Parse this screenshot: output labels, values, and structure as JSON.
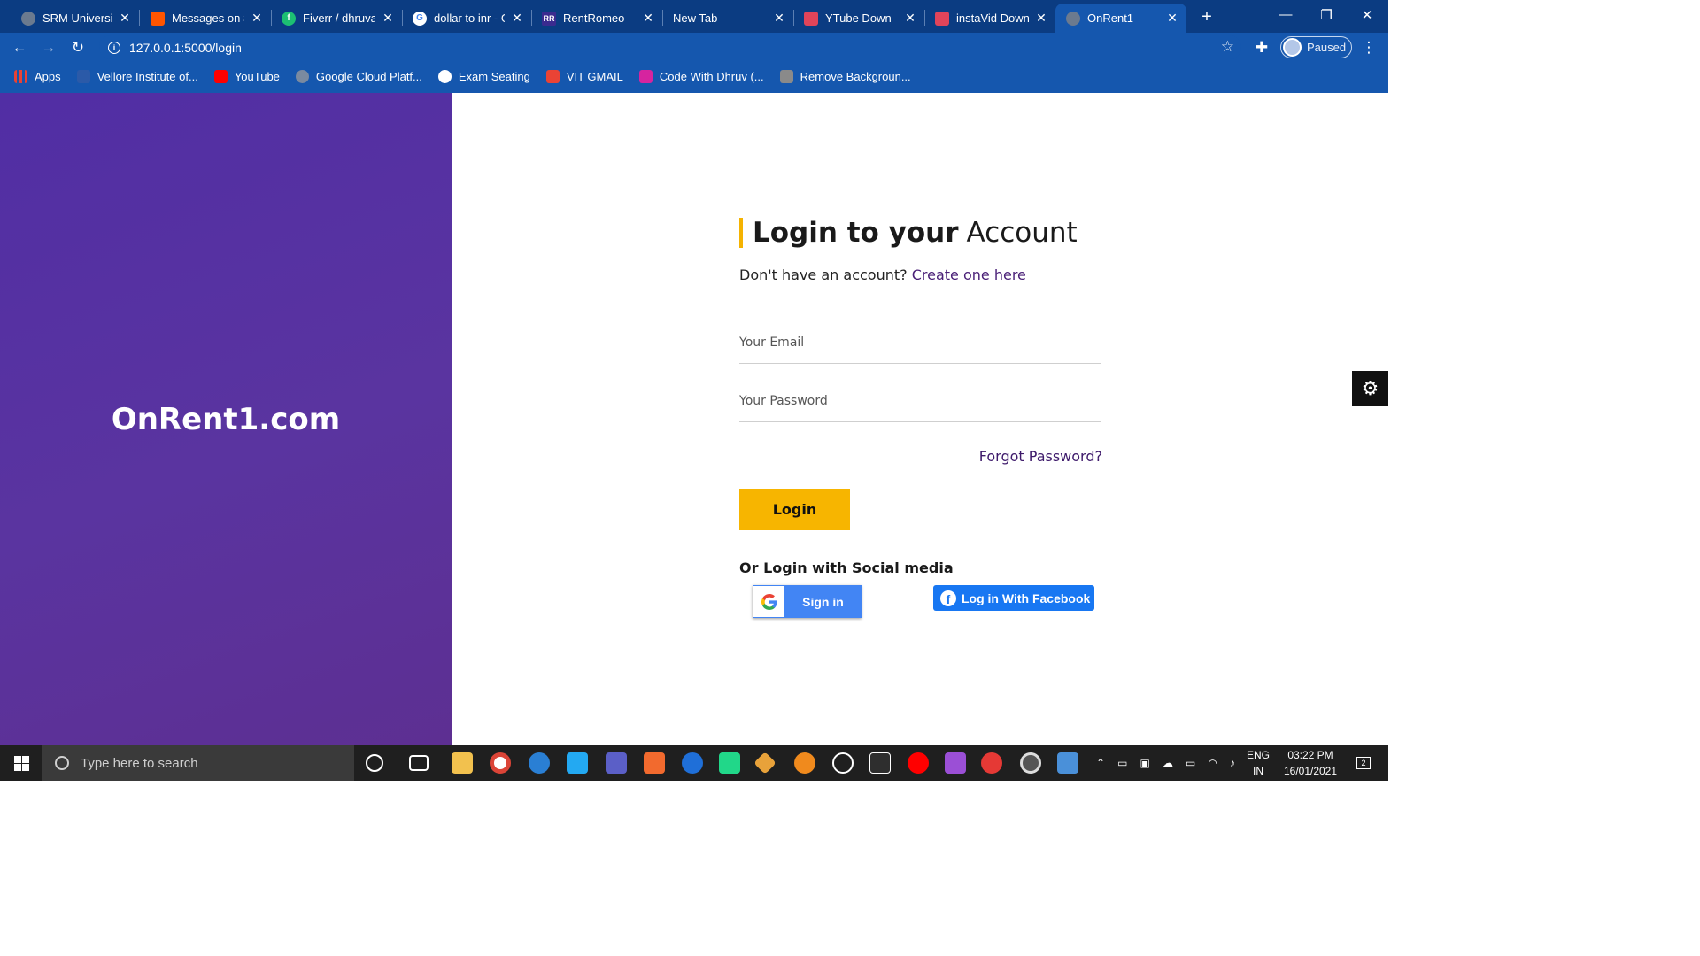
{
  "tabs": [
    {
      "title": "SRM University",
      "color": "#6b7a8f"
    },
    {
      "title": "Messages on S",
      "color": "#ff5500"
    },
    {
      "title": "Fiverr / dhruva",
      "color": "#1dbf73"
    },
    {
      "title": "dollar to inr - G",
      "color": "#ffffff"
    },
    {
      "title": "RentRomeo",
      "color": "#3b2b8f"
    },
    {
      "title": "New Tab",
      "color": "transparent"
    },
    {
      "title": "YTube Down",
      "color": "#e0445a"
    },
    {
      "title": "instaVid Down",
      "color": "#e0445a"
    },
    {
      "title": "OnRent1",
      "color": "#6b7a8f"
    }
  ],
  "window": {
    "minimize": "—",
    "restore": "❐",
    "close": "✕"
  },
  "toolbar": {
    "url": "127.0.0.1:5000/login",
    "profile_status": "Paused"
  },
  "bookmarks": [
    {
      "label": "Apps",
      "color": "#e94235"
    },
    {
      "label": "Vellore Institute of...",
      "color": "#2b5aa8"
    },
    {
      "label": "YouTube",
      "color": "#ff0000"
    },
    {
      "label": "Google Cloud Platf...",
      "color": "#7a8aa0"
    },
    {
      "label": "Exam Seating",
      "color": "#ffffff"
    },
    {
      "label": "VIT GMAIL",
      "color": "#ea4335"
    },
    {
      "label": "Code With Dhruv (...",
      "color": "#d6249f"
    },
    {
      "label": "Remove Backgroun...",
      "color": "#8a8a8a"
    }
  ],
  "page": {
    "brand": "OnRent1.com",
    "heading_bold": "Login to your",
    "heading_light": "Account",
    "no_account_text": "Don't have an account?",
    "create_link": "Create one here",
    "email_placeholder": "Your Email",
    "password_placeholder": "Your Password",
    "forgot": "Forgot Password?",
    "login_button": "Login",
    "social_title": "Or Login with Social media",
    "google_button": "Sign in",
    "facebook_button": "Log in With Facebook"
  },
  "taskbar": {
    "search_placeholder": "Type here to search",
    "language_line1": "ENG",
    "language_line2": "IN",
    "time": "03:22 PM",
    "date": "16/01/2021",
    "notification_count": "2"
  },
  "colors": {
    "accent_yellow": "#f7b500",
    "brand_purple": "#512ea4",
    "link_purple": "#4a2077",
    "facebook_blue": "#1877f2",
    "google_blue": "#4285f4"
  }
}
